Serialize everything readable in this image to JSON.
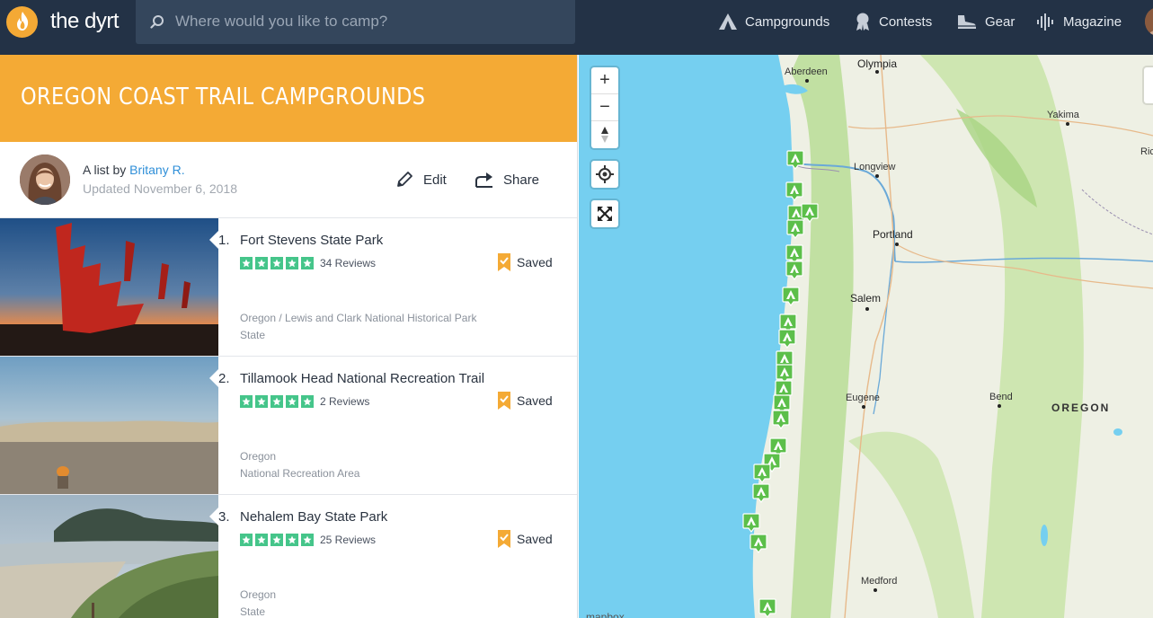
{
  "nav": {
    "logo_text": "the dyrt",
    "search_placeholder": "Where would you like to camp?",
    "links": [
      {
        "label": "Campgrounds",
        "icon": "tent-icon"
      },
      {
        "label": "Contests",
        "icon": "ribbon-icon"
      },
      {
        "label": "Gear",
        "icon": "boot-icon"
      },
      {
        "label": "Magazine",
        "icon": "soundwave-icon"
      }
    ]
  },
  "list": {
    "title": "OREGON COAST TRAIL CAMPGROUNDS",
    "byline_prefix": "A list by",
    "author": "Britany R.",
    "updated": "Updated November 6, 2018",
    "edit_label": "Edit",
    "share_label": "Share",
    "items": [
      {
        "num": "1.",
        "name": "Fort Stevens State Park",
        "rating": 5,
        "reviews": "34 Reviews",
        "saved_label": "Saved",
        "location": "Oregon / Lewis and Clark National Historical Park",
        "kind": "State"
      },
      {
        "num": "2.",
        "name": "Tillamook Head National Recreation Trail",
        "rating": 5,
        "reviews": "2 Reviews",
        "saved_label": "Saved",
        "location": "Oregon",
        "kind": "National Recreation Area"
      },
      {
        "num": "3.",
        "name": "Nehalem Bay State Park",
        "rating": 5,
        "reviews": "25 Reviews",
        "saved_label": "Saved",
        "location": "Oregon",
        "kind": "State"
      }
    ]
  },
  "map": {
    "zoom_in": "+",
    "zoom_out": "−",
    "cities": [
      {
        "name": "Aberdeen"
      },
      {
        "name": "Olympia"
      },
      {
        "name": "Yakima"
      },
      {
        "name": "Ric"
      },
      {
        "name": "Longview"
      },
      {
        "name": "Portland"
      },
      {
        "name": "Salem"
      },
      {
        "name": "Eugene"
      },
      {
        "name": "Bend"
      },
      {
        "name": "Medford"
      }
    ],
    "state_label": "OREGON",
    "attribution": "mapbox"
  },
  "colors": {
    "nav_bg": "#233246",
    "accent": "#f4aa35",
    "star_green": "#45c58a",
    "link_blue": "#2f8fd8",
    "marker_green": "#5cbf4a",
    "water": "#75cff0"
  }
}
